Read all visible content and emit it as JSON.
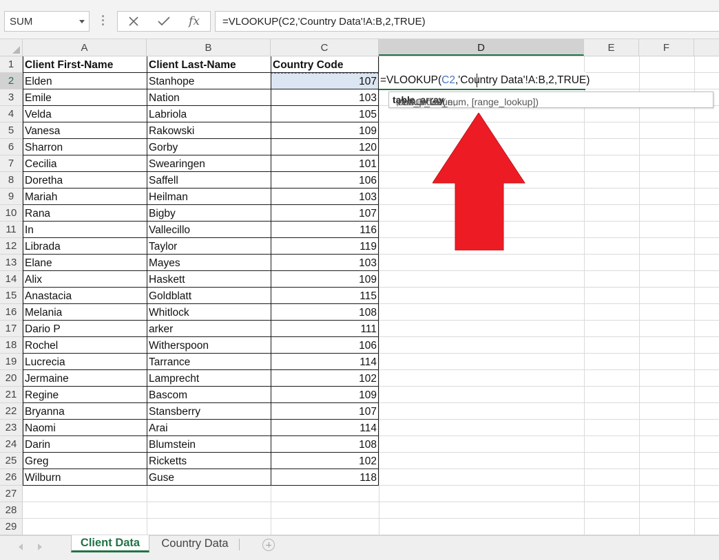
{
  "formula_bar": {
    "name_box": "SUM",
    "cancel_icon": "close-icon",
    "enter_icon": "check-icon",
    "function_icon": "fx-icon",
    "function_label": "fx",
    "formula": "=VLOOKUP(C2,'Country Data'!A:B,2,TRUE)"
  },
  "columns": [
    "A",
    "B",
    "C",
    "D",
    "E",
    "F"
  ],
  "selected_column": "D",
  "row_numbers": [
    "1",
    "2",
    "3",
    "4",
    "5",
    "6",
    "7",
    "8",
    "9",
    "10",
    "11",
    "12",
    "13",
    "14",
    "15",
    "16",
    "17",
    "18",
    "19",
    "20",
    "21",
    "22",
    "23",
    "24",
    "25",
    "26",
    "27",
    "28",
    "29"
  ],
  "selected_row": "2",
  "table": {
    "headers": [
      "Client First-Name",
      "Client Last-Name",
      "Country Code"
    ],
    "rows": [
      [
        "Elden",
        "Stanhope",
        "107"
      ],
      [
        "Emile",
        "Nation",
        "103"
      ],
      [
        "Velda",
        "Labriola",
        "105"
      ],
      [
        "Vanesa",
        "Rakowski",
        "109"
      ],
      [
        "Sharron",
        "Gorby",
        "120"
      ],
      [
        "Cecilia",
        "Swearingen",
        "101"
      ],
      [
        "Doretha",
        "Saffell",
        "106"
      ],
      [
        "Mariah",
        "Heilman",
        "103"
      ],
      [
        "Rana",
        "Bigby",
        "107"
      ],
      [
        "In",
        "Vallecillo",
        "116"
      ],
      [
        "Librada",
        "Taylor",
        "119"
      ],
      [
        "Elane",
        "Mayes",
        "103"
      ],
      [
        "Alix",
        "Haskett",
        "109"
      ],
      [
        "Anastacia",
        "Goldblatt",
        "115"
      ],
      [
        "Melania",
        "Whitlock",
        "108"
      ],
      [
        "Dario P",
        "arker",
        "111"
      ],
      [
        "Rochel",
        "Witherspoon",
        "106"
      ],
      [
        "Lucrecia",
        "Tarrance",
        "114"
      ],
      [
        "Jermaine",
        "Lamprecht",
        "102"
      ],
      [
        "Regine",
        "Bascom",
        "109"
      ],
      [
        "Bryanna",
        "Stansberry",
        "107"
      ],
      [
        "Naomi",
        "Arai",
        "114"
      ],
      [
        "Darin",
        "Blumstein",
        "108"
      ],
      [
        "Greg",
        "Ricketts",
        "102"
      ],
      [
        "Wilburn",
        "Guse",
        "118"
      ]
    ]
  },
  "editor": {
    "prefix": "=VLOOKUP(",
    "ref": "C2",
    "suffix": ",'Country Data'!A:B,2,TRUE)"
  },
  "tooltip": {
    "fn": "VLOOKUP(",
    "arg1": "lookup_value, ",
    "arg2_bold": "table_array",
    "rest": ", col_index_num, [range_lookup])"
  },
  "annotation": {
    "arrow_icon": "red-up-arrow-icon",
    "color": "#ed1c24"
  },
  "sheet_tabs": [
    {
      "label": "Client Data",
      "active": true
    },
    {
      "label": "Country Data",
      "active": false
    }
  ],
  "colors": {
    "accent": "#217346",
    "ref_blue": "#4472c4"
  }
}
